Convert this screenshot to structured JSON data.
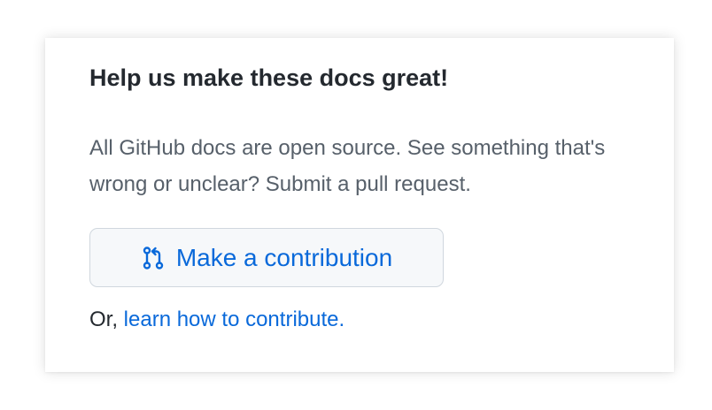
{
  "card": {
    "title": "Help us make these docs great!",
    "description": "All GitHub docs are open source. See something that's wrong or unclear? Submit a pull request.",
    "button": {
      "label": "Make a contribution",
      "icon": "git-pull-request-icon"
    },
    "alt_prefix": "Or, ",
    "alt_link": "learn how to contribute."
  },
  "colors": {
    "link": "#0969da",
    "heading": "#24292f",
    "muted": "#57606a",
    "button_bg": "#f6f8fa",
    "button_border": "#d0d7de"
  }
}
